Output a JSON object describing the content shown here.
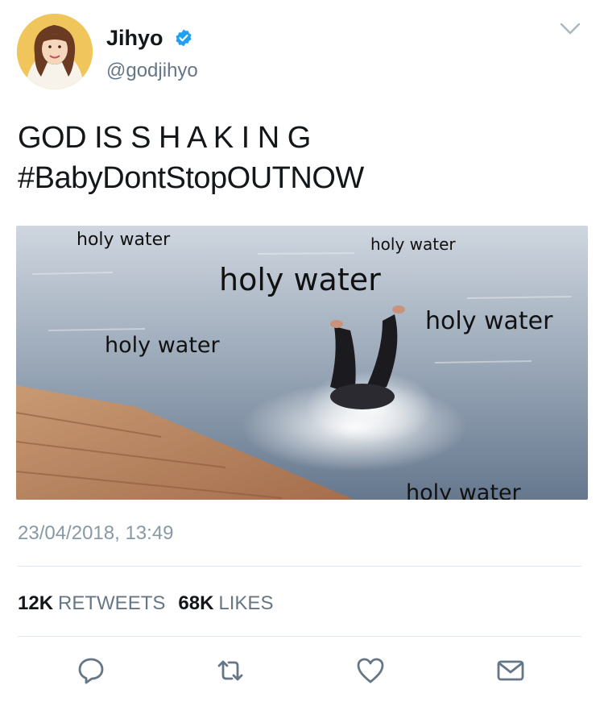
{
  "tweet": {
    "display_name": "Jihyo",
    "handle": "@godjihyo",
    "verified": true,
    "text_lines": [
      "GOD IS S H A K I N G",
      "#BabyDontStopOUTNOW"
    ],
    "timestamp": "23/04/2018, 13:49",
    "stats": {
      "retweets_count": "12K",
      "retweets_label": "RETWEETS",
      "likes_count": "68K",
      "likes_label": "LIKES"
    }
  },
  "media": {
    "labels": [
      "holy water",
      "holy water",
      "holy water",
      "holy water",
      "holy water",
      "holy water"
    ]
  },
  "icons": {
    "verified": "verified-badge-icon",
    "caret": "chevron-down-icon",
    "reply": "reply-icon",
    "retweet": "retweet-icon",
    "like": "heart-icon",
    "share": "envelope-icon"
  },
  "colors": {
    "accent": "#1da1f2",
    "icon_gray": "#657786",
    "text": "#14171a"
  }
}
